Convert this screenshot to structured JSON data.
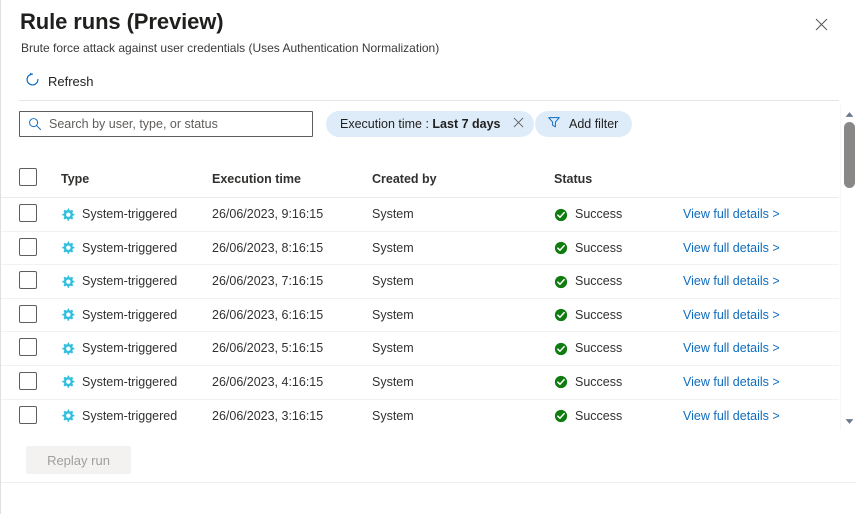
{
  "header": {
    "title": "Rule runs (Preview)",
    "subtitle": "Brute force attack against user credentials (Uses Authentication Normalization)",
    "close_label": "Close"
  },
  "commandbar": {
    "refresh_label": "Refresh"
  },
  "search": {
    "placeholder": "Search by user, type, or status",
    "value": ""
  },
  "filters": {
    "pill_prefix": "Execution time : ",
    "pill_value": "Last 7 days",
    "add_filter_label": "Add filter"
  },
  "table": {
    "columns": {
      "type": "Type",
      "execution_time": "Execution time",
      "created_by": "Created by",
      "status": "Status"
    },
    "rows": [
      {
        "type": "System-triggered",
        "execution_time": "26/06/2023, 9:16:15",
        "created_by": "System",
        "status": "Success",
        "link": "View full details >"
      },
      {
        "type": "System-triggered",
        "execution_time": "26/06/2023, 8:16:15",
        "created_by": "System",
        "status": "Success",
        "link": "View full details >"
      },
      {
        "type": "System-triggered",
        "execution_time": "26/06/2023, 7:16:15",
        "created_by": "System",
        "status": "Success",
        "link": "View full details >"
      },
      {
        "type": "System-triggered",
        "execution_time": "26/06/2023, 6:16:15",
        "created_by": "System",
        "status": "Success",
        "link": "View full details >"
      },
      {
        "type": "System-triggered",
        "execution_time": "26/06/2023, 5:16:15",
        "created_by": "System",
        "status": "Success",
        "link": "View full details >"
      },
      {
        "type": "System-triggered",
        "execution_time": "26/06/2023, 4:16:15",
        "created_by": "System",
        "status": "Success",
        "link": "View full details >"
      },
      {
        "type": "System-triggered",
        "execution_time": "26/06/2023, 3:16:15",
        "created_by": "System",
        "status": "Success",
        "link": "View full details >"
      }
    ]
  },
  "footer": {
    "replay_label": "Replay run"
  },
  "colors": {
    "accent": "#0f6cbd",
    "gear": "#32bedd",
    "success": "#107c10",
    "pill_bg": "#deecf9",
    "scroll_thumb": "#8a8886"
  }
}
